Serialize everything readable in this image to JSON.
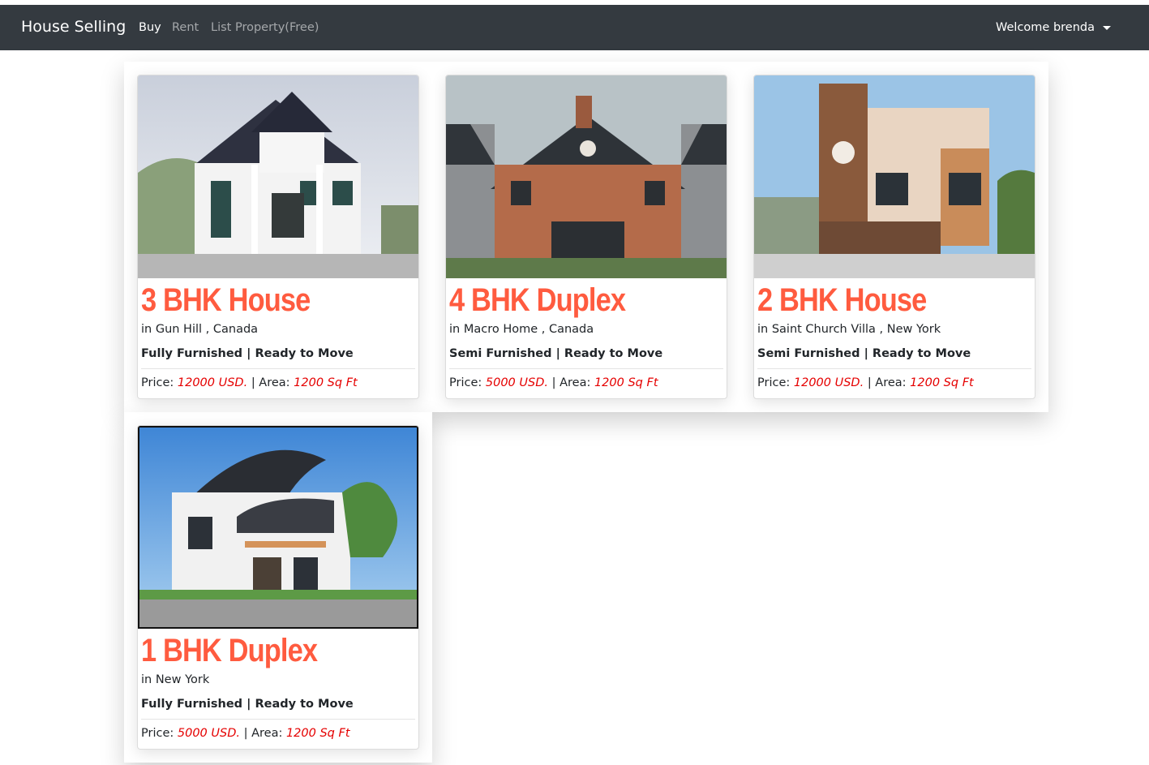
{
  "navbar": {
    "brand": "House Selling",
    "links": [
      "Buy",
      "Rent",
      "List Property(Free)"
    ],
    "user_menu": "Welcome brenda",
    "bg_color": "#343a40"
  },
  "listings": [
    {
      "title": "3 BHK House",
      "location": "in Gun Hill , Canada",
      "furnishing": "Fully Furnished | Ready to Move",
      "price_label": "Price:",
      "price": "12000 USD.",
      "area_label": "| Area:",
      "area": "1200 Sq Ft",
      "image": "white-mansion-photo"
    },
    {
      "title": "4 BHK Duplex",
      "location": "in Macro Home , Canada",
      "furnishing": "Semi Furnished | Ready to Move",
      "price_label": "Price:",
      "price": "5000 USD.",
      "area_label": "| Area:",
      "area": "1200 Sq Ft",
      "image": "brick-house-photo"
    },
    {
      "title": "2 BHK House",
      "location": "in Saint Church Villa , New York",
      "furnishing": "Semi Furnished | Ready to Move",
      "price_label": "Price:",
      "price": "12000 USD.",
      "area_label": "| Area:",
      "area": "1200 Sq Ft",
      "image": "modern-house-photo"
    },
    {
      "title": "1 BHK Duplex",
      "location": "in New York",
      "furnishing": "Fully Furnished | Ready to Move",
      "price_label": "Price:",
      "price": "5000 USD.",
      "area_label": "| Area:",
      "area": "1200 Sq Ft",
      "image": "villa-render-photo"
    }
  ],
  "colors": {
    "title": "#ff5b3f",
    "price": "#e50000"
  }
}
